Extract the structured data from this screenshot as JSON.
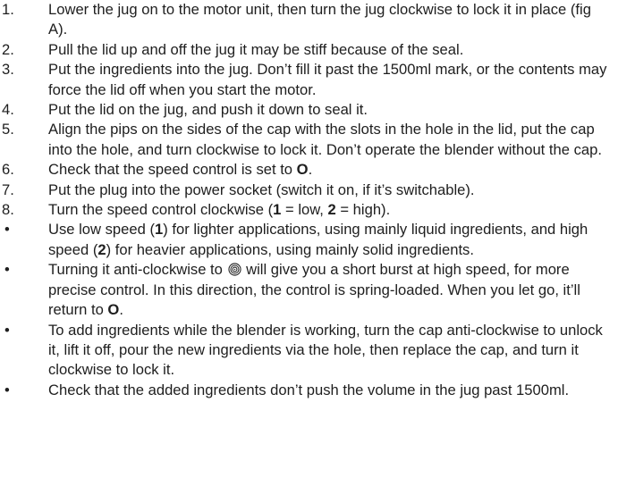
{
  "steps": [
    {
      "marker": "1.",
      "text": "Lower the jug on to the motor unit, then turn the jug clockwise to lock it in place (fig A)."
    },
    {
      "marker": "2.",
      "text": "Pull the lid up and off the jug it may be stiff because of the seal."
    },
    {
      "marker": "3.",
      "text": "Put the ingredients into the jug. Don’t fill it past the 1500ml mark, or the contents may force the lid off when you start the motor."
    },
    {
      "marker": "4.",
      "text": "Put the lid on the jug, and push it down to seal it."
    },
    {
      "marker": "5.",
      "text": "Align the pips on the sides of the cap with the slots in the hole in the lid, put the cap into the hole, and turn clockwise to lock it. Don’t operate the blender without the cap."
    },
    {
      "marker": "6.",
      "text_before": "Check that the speed control is set to ",
      "bold": "O",
      "text_after": "."
    },
    {
      "marker": "7.",
      "text": "Put the plug into the power socket (switch it on, if it’s switchable)."
    },
    {
      "marker": "8.",
      "parts": [
        "Turn the speed control clockwise (",
        "1",
        " = low, ",
        "2",
        " = high)."
      ]
    }
  ],
  "bullets": [
    {
      "marker": "•",
      "parts": [
        "Use low speed (",
        "1",
        ") for lighter applications, using mainly liquid ingredients, and high speed (",
        "2",
        ") for heavier applications, using mainly solid ingredients."
      ]
    },
    {
      "marker": "•",
      "text_before": "Turning it anti-clockwise to ",
      "icon": "pulse-swirl-icon",
      "text_middle": " will give you a short burst at high speed, for more precise control. In this direction, the control is spring-loaded. When you let go, it’ll return to ",
      "bold": "O",
      "text_after": "."
    },
    {
      "marker": "•",
      "text": "To add ingredients while the blender is working, turn the cap anti-clockwise to unlock it, lift it off, pour the new ingredients via the hole, then replace the cap, and turn it clockwise to lock it."
    },
    {
      "marker": "•",
      "text": "Check that the added ingredients don’t push the volume in the jug past 1500ml."
    }
  ]
}
